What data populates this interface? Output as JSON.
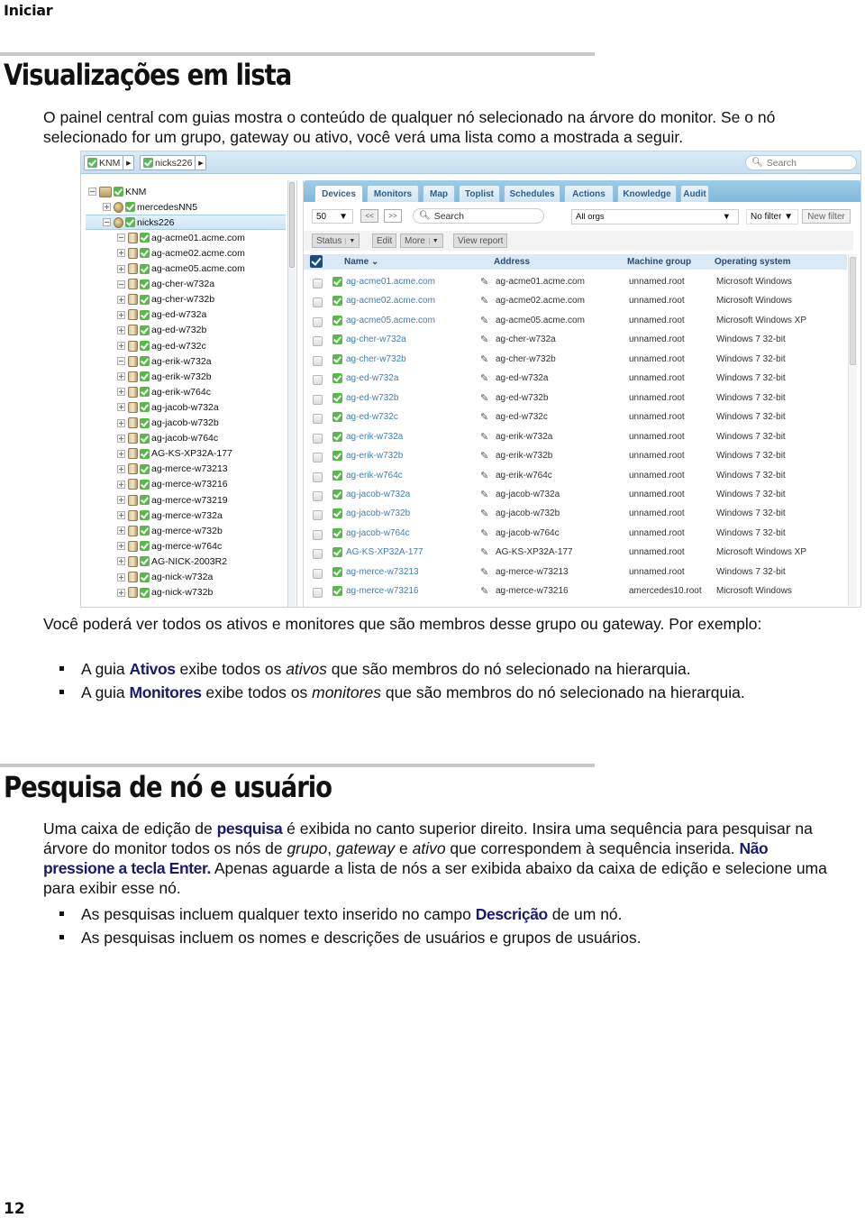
{
  "running_header": "Iniciar",
  "section1": {
    "title": "Visualizações em lista",
    "intro": "O painel central com guias mostra o conteúdo de qualquer nó selecionado na árvore do monitor. Se o nó selecionado for um grupo, gateway ou ativo, você verá uma lista como a mostrada a seguir.",
    "after_intro": "Você poderá ver todos os ativos e monitores que são membros desse grupo ou gateway. Por exemplo:",
    "bullets": [
      {
        "pre": "A guia ",
        "kw": "Ativos",
        "mid": " exibe todos os ",
        "em": "ativos",
        "post": " que são membros do nó selecionado na hierarquia."
      },
      {
        "pre": "A guia ",
        "kw": "Monitores",
        "mid": " exibe todos os ",
        "em": "monitores",
        "post": " que são membros do nó selecionado na hierarquia."
      }
    ]
  },
  "screenshot": {
    "breadcrumbs": [
      {
        "label": "KNM"
      },
      {
        "label": "nicks226"
      }
    ],
    "search_placeholder": "Search",
    "tree": [
      {
        "label": "KNM",
        "toggle": "minus",
        "icon": "folder",
        "level": 0
      },
      {
        "label": "mercedesNN5",
        "toggle": "plus",
        "icon": "globe",
        "level": 1
      },
      {
        "label": "nicks226",
        "toggle": "minus",
        "icon": "globe",
        "level": 1,
        "selected": true
      },
      {
        "label": "ag-acme01.acme.com",
        "toggle": "minus",
        "icon": "box",
        "level": 2
      },
      {
        "label": "ag-acme02.acme.com",
        "toggle": "plus",
        "icon": "box",
        "level": 2
      },
      {
        "label": "ag-acme05.acme.com",
        "toggle": "plus",
        "icon": "box",
        "level": 2
      },
      {
        "label": "ag-cher-w732a",
        "toggle": "minus",
        "icon": "box",
        "level": 2
      },
      {
        "label": "ag-cher-w732b",
        "toggle": "plus",
        "icon": "box",
        "level": 2
      },
      {
        "label": "ag-ed-w732a",
        "toggle": "plus",
        "icon": "box",
        "level": 2
      },
      {
        "label": "ag-ed-w732b",
        "toggle": "plus",
        "icon": "box",
        "level": 2
      },
      {
        "label": "ag-ed-w732c",
        "toggle": "plus",
        "icon": "box",
        "level": 2
      },
      {
        "label": "ag-erik-w732a",
        "toggle": "minus",
        "icon": "box",
        "level": 2
      },
      {
        "label": "ag-erik-w732b",
        "toggle": "plus",
        "icon": "box",
        "level": 2
      },
      {
        "label": "ag-erik-w764c",
        "toggle": "plus",
        "icon": "box",
        "level": 2
      },
      {
        "label": "ag-jacob-w732a",
        "toggle": "plus",
        "icon": "box",
        "level": 2
      },
      {
        "label": "ag-jacob-w732b",
        "toggle": "plus",
        "icon": "box",
        "level": 2
      },
      {
        "label": "ag-jacob-w764c",
        "toggle": "plus",
        "icon": "box",
        "level": 2
      },
      {
        "label": "AG-KS-XP32A-177",
        "toggle": "plus",
        "icon": "box",
        "level": 2
      },
      {
        "label": "ag-merce-w73213",
        "toggle": "plus",
        "icon": "box",
        "level": 2
      },
      {
        "label": "ag-merce-w73216",
        "toggle": "plus",
        "icon": "box",
        "level": 2
      },
      {
        "label": "ag-merce-w73219",
        "toggle": "plus",
        "icon": "box",
        "level": 2
      },
      {
        "label": "ag-merce-w732a",
        "toggle": "plus",
        "icon": "box",
        "level": 2
      },
      {
        "label": "ag-merce-w732b",
        "toggle": "plus",
        "icon": "box",
        "level": 2
      },
      {
        "label": "ag-merce-w764c",
        "toggle": "plus",
        "icon": "box",
        "level": 2
      },
      {
        "label": "AG-NICK-2003R2",
        "toggle": "plus",
        "icon": "box",
        "level": 2
      },
      {
        "label": "ag-nick-w732a",
        "toggle": "plus",
        "icon": "box",
        "level": 2
      },
      {
        "label": "ag-nick-w732b",
        "toggle": "plus",
        "icon": "box",
        "level": 2
      }
    ],
    "tabs": [
      "Devices",
      "Monitors",
      "Map",
      "Toplist",
      "Schedules",
      "Actions",
      "Knowledge",
      "Audit"
    ],
    "active_tab": "Devices",
    "page_size": "50",
    "prev_label": "<<",
    "next_label": ">>",
    "grid_search_placeholder": "Search",
    "org_select": "All orgs",
    "filter_select": "No filter",
    "new_filter_label": "New filter",
    "actions": {
      "status": "Status",
      "edit": "Edit",
      "more": "More",
      "view_report": "View report"
    },
    "columns": {
      "name": "Name",
      "address": "Address",
      "machine_group": "Machine group",
      "os": "Operating system"
    },
    "rows": [
      {
        "name": "ag-acme01.acme.com",
        "address": "ag-acme01.acme.com",
        "group": "unnamed.root",
        "os": "Microsoft Windows"
      },
      {
        "name": "ag-acme02.acme.com",
        "address": "ag-acme02.acme.com",
        "group": "unnamed.root",
        "os": "Microsoft Windows"
      },
      {
        "name": "ag-acme05.acme.com",
        "address": "ag-acme05.acme.com",
        "group": "unnamed.root",
        "os": "Microsoft Windows XP"
      },
      {
        "name": "ag-cher-w732a",
        "address": "ag-cher-w732a",
        "group": "unnamed.root",
        "os": "Windows 7 32-bit"
      },
      {
        "name": "ag-cher-w732b",
        "address": "ag-cher-w732b",
        "group": "unnamed.root",
        "os": "Windows 7 32-bit"
      },
      {
        "name": "ag-ed-w732a",
        "address": "ag-ed-w732a",
        "group": "unnamed.root",
        "os": "Windows 7 32-bit"
      },
      {
        "name": "ag-ed-w732b",
        "address": "ag-ed-w732b",
        "group": "unnamed.root",
        "os": "Windows 7 32-bit"
      },
      {
        "name": "ag-ed-w732c",
        "address": "ag-ed-w732c",
        "group": "unnamed.root",
        "os": "Windows 7 32-bit"
      },
      {
        "name": "ag-erik-w732a",
        "address": "ag-erik-w732a",
        "group": "unnamed.root",
        "os": "Windows 7 32-bit"
      },
      {
        "name": "ag-erik-w732b",
        "address": "ag-erik-w732b",
        "group": "unnamed.root",
        "os": "Windows 7 32-bit"
      },
      {
        "name": "ag-erik-w764c",
        "address": "ag-erik-w764c",
        "group": "unnamed.root",
        "os": "Windows 7 32-bit"
      },
      {
        "name": "ag-jacob-w732a",
        "address": "ag-jacob-w732a",
        "group": "unnamed.root",
        "os": "Windows 7 32-bit"
      },
      {
        "name": "ag-jacob-w732b",
        "address": "ag-jacob-w732b",
        "group": "unnamed.root",
        "os": "Windows 7 32-bit"
      },
      {
        "name": "ag-jacob-w764c",
        "address": "ag-jacob-w764c",
        "group": "unnamed.root",
        "os": "Windows 7 32-bit"
      },
      {
        "name": "AG-KS-XP32A-177",
        "address": "AG-KS-XP32A-177",
        "group": "unnamed.root",
        "os": "Microsoft Windows XP"
      },
      {
        "name": "ag-merce-w73213",
        "address": "ag-merce-w73213",
        "group": "unnamed.root",
        "os": "Windows 7 32-bit"
      },
      {
        "name": "ag-merce-w73216",
        "address": "ag-merce-w73216",
        "group": "amercedes10.root",
        "os": "Microsoft Windows"
      }
    ]
  },
  "section2": {
    "title": "Pesquisa de nó e usuário",
    "para": {
      "p1": "Uma caixa de edição de ",
      "kw1": "pesquisa",
      "p2": " é exibida no canto superior direito. Insira uma sequência para pesquisar na árvore do monitor todos os nós de ",
      "em1": "grupo",
      "p3": ", ",
      "em2": "gateway",
      "p4": " e ",
      "em3": "ativo",
      "p5": " que correspondem à sequência inserida. ",
      "kw2": "Não pressione a tecla Enter.",
      "p6": " Apenas aguarde a lista de nós a ser exibida abaixo da caixa de edição e selecione uma para exibir esse nó."
    },
    "bullets": [
      {
        "pre": "As pesquisas incluem qualquer texto inserido no campo ",
        "kw": "Descrição",
        "post": " de um nó."
      },
      {
        "pre": "As pesquisas incluem os nomes e descrições de usuários e grupos de usuários.",
        "kw": "",
        "post": ""
      }
    ]
  },
  "page_number": "12"
}
